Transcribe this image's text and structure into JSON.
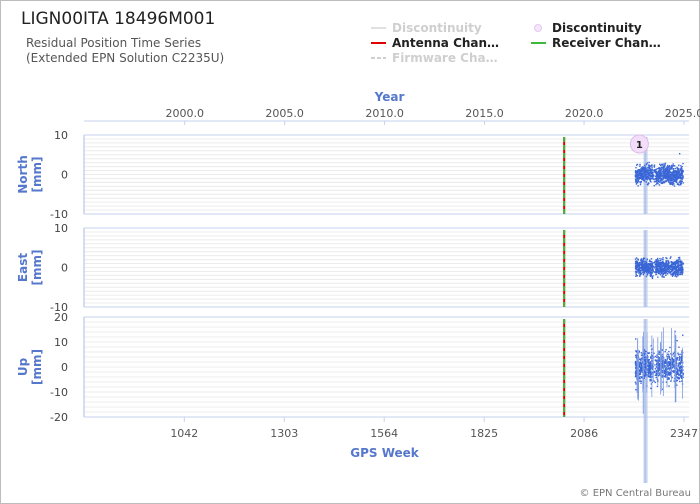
{
  "header": {
    "title": "LIGN00ITA 18496M001",
    "subtitle_line1": "Residual Position Time Series",
    "subtitle_line2": "(Extended EPN Solution C2235U)"
  },
  "legend": [
    {
      "label": "Discontinuity",
      "style": "line",
      "color": "#e0e0e0",
      "dimmed": true
    },
    {
      "label": "Discontinuity",
      "style": "circle",
      "color": "#e6c8f0",
      "dimmed": false
    },
    {
      "label": "Antenna Chan…",
      "style": "line",
      "color": "#e00000",
      "dimmed": false
    },
    {
      "label": "Receiver Chan…",
      "style": "line",
      "color": "#3cb83c",
      "dimmed": false
    },
    {
      "label": "Firmware Cha…",
      "style": "dash",
      "color": "#d0d0d0",
      "dimmed": true
    }
  ],
  "credit": "© EPN Central Bureau",
  "chart_data": {
    "type": "scatter",
    "x_axis_bottom": {
      "label": "GPS Week",
      "ticks": [
        1042,
        1303,
        1564,
        1825,
        2086,
        2347
      ],
      "range": [
        780,
        2360
      ]
    },
    "x_axis_top": {
      "label": "Year",
      "ticks": [
        "2000.0",
        "2005.0",
        "2010.0",
        "2015.0",
        "2020.0",
        "2025.0"
      ],
      "tick_weeks": [
        1043,
        1304,
        1565,
        1826,
        2086,
        2347
      ]
    },
    "panels": [
      {
        "name": "North",
        "ylabel": "North\n[mm]",
        "ylim": [
          -10,
          10
        ],
        "yticks": [
          10,
          0,
          -10
        ],
        "scatter_amplitude": 3.5
      },
      {
        "name": "East",
        "ylabel": "East\n[mm]",
        "ylim": [
          -10,
          10
        ],
        "yticks": [
          10,
          0,
          -10
        ],
        "scatter_amplitude": 3.0
      },
      {
        "name": "Up",
        "ylabel": "Up\n[mm]",
        "ylim": [
          -20,
          20
        ],
        "yticks": [
          20,
          10,
          0,
          -10,
          -20
        ],
        "scatter_amplitude": 9.0
      }
    ],
    "data_span_weeks": [
      2220,
      2345
    ],
    "antenna_change_week": 2034,
    "receiver_change_week": 2034,
    "discontinuity_marker": {
      "label": "1",
      "week": 2220
    },
    "vertical_lines_weeks": [
      2243,
      2246,
      2250
    ],
    "series_color": "#3a66d6",
    "grid": true
  }
}
